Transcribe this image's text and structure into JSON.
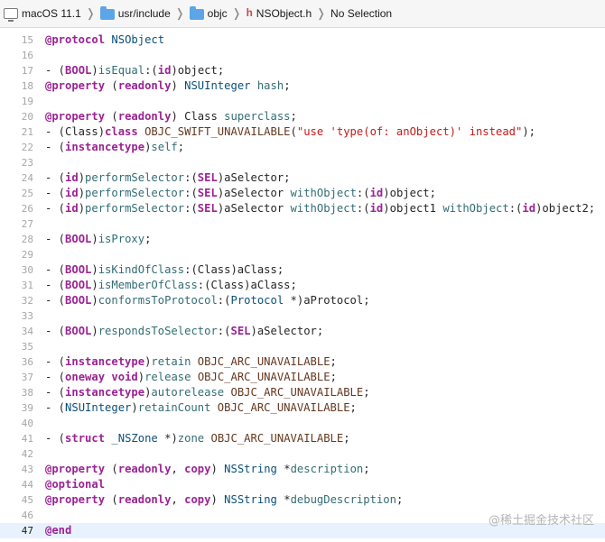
{
  "breadcrumb": {
    "items": [
      {
        "label": "macOS 11.1",
        "icon": "mac-icon"
      },
      {
        "label": "usr/include",
        "icon": "folder-icon"
      },
      {
        "label": "objc",
        "icon": "folder-icon"
      },
      {
        "label": "NSObject.h",
        "icon": "h",
        "icon_name": "header-file-icon"
      },
      {
        "label": "No Selection"
      }
    ]
  },
  "editor": {
    "active_line": "47",
    "lines": [
      {
        "n": "15",
        "t": [
          [
            "@protocol",
            "kw"
          ],
          [
            " "
          ],
          [
            "NSObject",
            "ty"
          ]
        ]
      },
      {
        "n": "16",
        "t": []
      },
      {
        "n": "17",
        "t": [
          [
            "- ("
          ],
          [
            "BOOL",
            "kw"
          ],
          [
            ")"
          ],
          [
            "isEqual",
            "fn"
          ],
          [
            ":("
          ],
          [
            "id",
            "kw"
          ],
          [
            ")object;"
          ]
        ]
      },
      {
        "n": "18",
        "t": [
          [
            "@property",
            "kw"
          ],
          [
            " ("
          ],
          [
            "readonly",
            "kw"
          ],
          [
            ") "
          ],
          [
            "NSUInteger",
            "ty"
          ],
          [
            " "
          ],
          [
            "hash",
            "fn"
          ],
          [
            ";"
          ]
        ]
      },
      {
        "n": "19",
        "t": []
      },
      {
        "n": "20",
        "t": [
          [
            "@property",
            "kw"
          ],
          [
            " ("
          ],
          [
            "readonly",
            "kw"
          ],
          [
            ") Class "
          ],
          [
            "superclass",
            "fn"
          ],
          [
            ";"
          ]
        ]
      },
      {
        "n": "21",
        "t": [
          [
            "- (Class)"
          ],
          [
            "class",
            "kw"
          ],
          [
            " "
          ],
          [
            "OBJC_SWIFT_UNAVAILABLE",
            "mc"
          ],
          [
            "("
          ],
          [
            "\"use 'type(of: anObject)' instead\"",
            "st"
          ],
          [
            ");"
          ]
        ]
      },
      {
        "n": "22",
        "t": [
          [
            "- ("
          ],
          [
            "instancetype",
            "kw"
          ],
          [
            ")"
          ],
          [
            "self",
            "fn"
          ],
          [
            ";"
          ]
        ]
      },
      {
        "n": "23",
        "t": []
      },
      {
        "n": "24",
        "t": [
          [
            "- ("
          ],
          [
            "id",
            "kw"
          ],
          [
            ")"
          ],
          [
            "performSelector",
            "fn"
          ],
          [
            ":("
          ],
          [
            "SEL",
            "kw"
          ],
          [
            ")aSelector;"
          ]
        ]
      },
      {
        "n": "25",
        "t": [
          [
            "- ("
          ],
          [
            "id",
            "kw"
          ],
          [
            ")"
          ],
          [
            "performSelector",
            "fn"
          ],
          [
            ":("
          ],
          [
            "SEL",
            "kw"
          ],
          [
            ")aSelector "
          ],
          [
            "withObject",
            "fn"
          ],
          [
            ":("
          ],
          [
            "id",
            "kw"
          ],
          [
            ")object;"
          ]
        ]
      },
      {
        "n": "26",
        "t": [
          [
            "- ("
          ],
          [
            "id",
            "kw"
          ],
          [
            ")"
          ],
          [
            "performSelector",
            "fn"
          ],
          [
            ":("
          ],
          [
            "SEL",
            "kw"
          ],
          [
            ")aSelector "
          ],
          [
            "withObject",
            "fn"
          ],
          [
            ":("
          ],
          [
            "id",
            "kw"
          ],
          [
            ")object1 "
          ],
          [
            "withObject",
            "fn"
          ],
          [
            ":("
          ],
          [
            "id",
            "kw"
          ],
          [
            ")object2;"
          ]
        ]
      },
      {
        "n": "27",
        "t": []
      },
      {
        "n": "28",
        "t": [
          [
            "- ("
          ],
          [
            "BOOL",
            "kw"
          ],
          [
            ")"
          ],
          [
            "isProxy",
            "fn"
          ],
          [
            ";"
          ]
        ]
      },
      {
        "n": "29",
        "t": []
      },
      {
        "n": "30",
        "t": [
          [
            "- ("
          ],
          [
            "BOOL",
            "kw"
          ],
          [
            ")"
          ],
          [
            "isKindOfClass",
            "fn"
          ],
          [
            ":(Class)aClass;"
          ]
        ]
      },
      {
        "n": "31",
        "t": [
          [
            "- ("
          ],
          [
            "BOOL",
            "kw"
          ],
          [
            ")"
          ],
          [
            "isMemberOfClass",
            "fn"
          ],
          [
            ":(Class)aClass;"
          ]
        ]
      },
      {
        "n": "32",
        "t": [
          [
            "- ("
          ],
          [
            "BOOL",
            "kw"
          ],
          [
            ")"
          ],
          [
            "conformsToProtocol",
            "fn"
          ],
          [
            ":("
          ],
          [
            "Protocol",
            "ty"
          ],
          [
            " *)aProtocol;"
          ]
        ]
      },
      {
        "n": "33",
        "t": []
      },
      {
        "n": "34",
        "t": [
          [
            "- ("
          ],
          [
            "BOOL",
            "kw"
          ],
          [
            ")"
          ],
          [
            "respondsToSelector",
            "fn"
          ],
          [
            ":("
          ],
          [
            "SEL",
            "kw"
          ],
          [
            ")aSelector;"
          ]
        ]
      },
      {
        "n": "35",
        "t": []
      },
      {
        "n": "36",
        "t": [
          [
            "- ("
          ],
          [
            "instancetype",
            "kw"
          ],
          [
            ")"
          ],
          [
            "retain",
            "fn"
          ],
          [
            " "
          ],
          [
            "OBJC_ARC_UNAVAILABLE",
            "mc"
          ],
          [
            ";"
          ]
        ]
      },
      {
        "n": "37",
        "t": [
          [
            "- ("
          ],
          [
            "oneway",
            "kw"
          ],
          [
            " "
          ],
          [
            "void",
            "kw"
          ],
          [
            ")"
          ],
          [
            "release",
            "fn"
          ],
          [
            " "
          ],
          [
            "OBJC_ARC_UNAVAILABLE",
            "mc"
          ],
          [
            ";"
          ]
        ]
      },
      {
        "n": "38",
        "t": [
          [
            "- ("
          ],
          [
            "instancetype",
            "kw"
          ],
          [
            ")"
          ],
          [
            "autorelease",
            "fn"
          ],
          [
            " "
          ],
          [
            "OBJC_ARC_UNAVAILABLE",
            "mc"
          ],
          [
            ";"
          ]
        ]
      },
      {
        "n": "39",
        "t": [
          [
            "- ("
          ],
          [
            "NSUInteger",
            "ty"
          ],
          [
            ")"
          ],
          [
            "retainCount",
            "fn"
          ],
          [
            " "
          ],
          [
            "OBJC_ARC_UNAVAILABLE",
            "mc"
          ],
          [
            ";"
          ]
        ]
      },
      {
        "n": "40",
        "t": []
      },
      {
        "n": "41",
        "t": [
          [
            "- ("
          ],
          [
            "struct",
            "kw"
          ],
          [
            " "
          ],
          [
            "_NSZone",
            "ty"
          ],
          [
            " *)"
          ],
          [
            "zone",
            "fn"
          ],
          [
            " "
          ],
          [
            "OBJC_ARC_UNAVAILABLE",
            "mc"
          ],
          [
            ";"
          ]
        ]
      },
      {
        "n": "42",
        "t": []
      },
      {
        "n": "43",
        "t": [
          [
            "@property",
            "kw"
          ],
          [
            " ("
          ],
          [
            "readonly",
            "kw"
          ],
          [
            ", "
          ],
          [
            "copy",
            "kw"
          ],
          [
            ") "
          ],
          [
            "NSString",
            "ty"
          ],
          [
            " *"
          ],
          [
            "description",
            "fn"
          ],
          [
            ";"
          ]
        ]
      },
      {
        "n": "44",
        "t": [
          [
            "@optional",
            "kw"
          ]
        ]
      },
      {
        "n": "45",
        "t": [
          [
            "@property",
            "kw"
          ],
          [
            " ("
          ],
          [
            "readonly",
            "kw"
          ],
          [
            ", "
          ],
          [
            "copy",
            "kw"
          ],
          [
            ") "
          ],
          [
            "NSString",
            "ty"
          ],
          [
            " *"
          ],
          [
            "debugDescription",
            "fn"
          ],
          [
            ";"
          ]
        ]
      },
      {
        "n": "46",
        "t": []
      },
      {
        "n": "47",
        "t": [
          [
            "@end",
            "kw"
          ]
        ]
      }
    ]
  },
  "watermark": "@稀土掘金技术社区",
  "colors": {
    "keyword": "#9b2393",
    "type": "#0b4f79",
    "function": "#326d74",
    "string": "#c41a16",
    "macro": "#643820",
    "active_line_bg": "#e8f2ff"
  }
}
